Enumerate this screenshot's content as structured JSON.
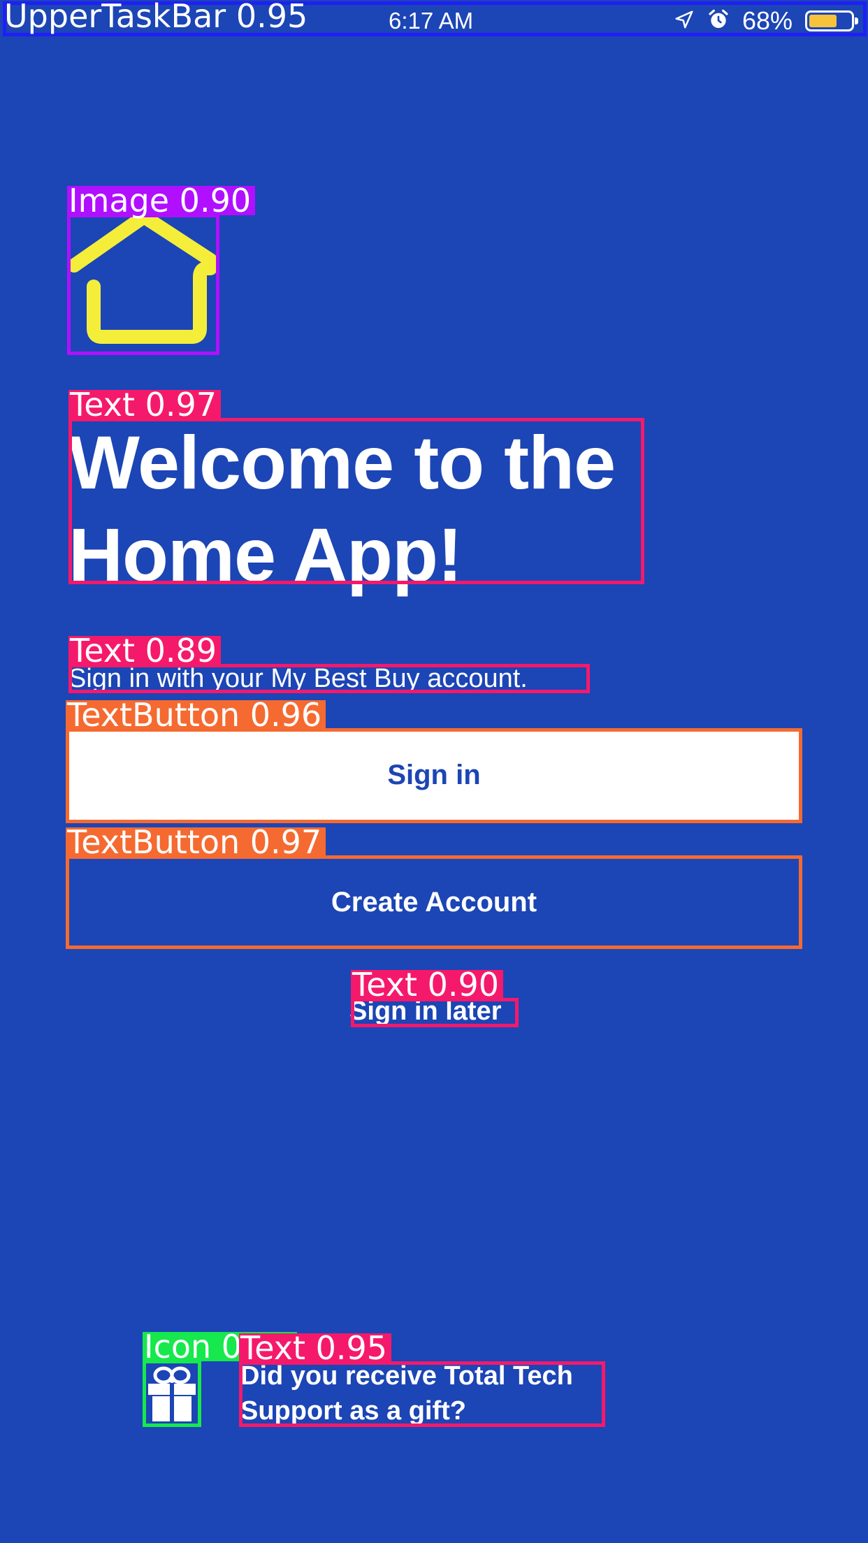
{
  "status_bar": {
    "time": "6:17 AM",
    "battery_text": "68%",
    "battery_level": 0.68,
    "icons": [
      "location-arrow-icon",
      "alarm-clock-icon",
      "battery-icon"
    ]
  },
  "onboarding": {
    "logo_icon": "home-icon",
    "title": "Welcome to the Home App!",
    "subtitle": "Sign in with your My Best Buy account.",
    "sign_in_label": "Sign in",
    "create_account_label": "Create Account",
    "sign_in_later_label": "Sign in later",
    "gift_icon": "gift-icon",
    "gift_prompt": "Did you receive Total Tech Support as a gift?"
  },
  "detections": [
    {
      "label": "UpperTaskBar 0.95",
      "color": "#1f1ff5"
    },
    {
      "label": "Image 0.90",
      "color": "#b010ff"
    },
    {
      "label": "Text 0.97",
      "color": "#f5196b"
    },
    {
      "label": "Text 0.89",
      "color": "#f5196b"
    },
    {
      "label": "TextButton 0.96",
      "color": "#f56a30"
    },
    {
      "label": "TextButton 0.97",
      "color": "#f56a30"
    },
    {
      "label": "Text 0.90",
      "color": "#f5196b"
    },
    {
      "label": "Icon 0.97",
      "color": "#16e84d"
    },
    {
      "label": "Text 0.95",
      "color": "#f5196b"
    }
  ],
  "colors": {
    "background": "#1c45b5",
    "logo_yellow": "#f4ee3a",
    "battery_fill": "#f6c33a"
  }
}
